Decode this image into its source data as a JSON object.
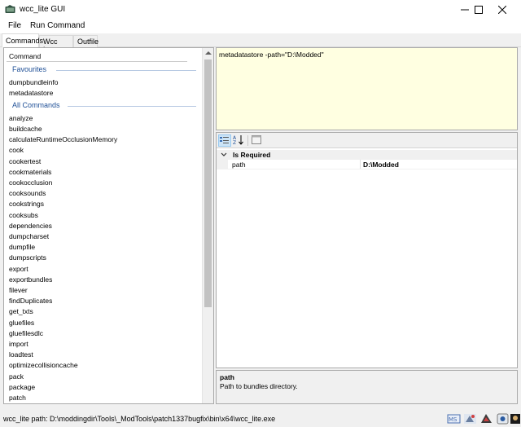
{
  "window": {
    "title": "wcc_lite GUI"
  },
  "menu": {
    "items": [
      "File",
      "Run Command"
    ]
  },
  "tabs": [
    "Commands",
    "Wcc Log",
    "Outfile"
  ],
  "commands_panel": {
    "header": "Command",
    "favourites_label": "Favourites",
    "favourites": [
      "dumpbundleinfo",
      "metadatastore"
    ],
    "all_label": "All Commands",
    "all_commands": [
      "analyze",
      "buildcache",
      "calculateRuntimeOcclusionMemory",
      "cook",
      "cookertest",
      "cookmaterials",
      "cookocclusion",
      "cooksounds",
      "cookstrings",
      "cooksubs",
      "dependencies",
      "dumpcharset",
      "dumpfile",
      "dumpscripts",
      "export",
      "exportbundles",
      "filever",
      "findDuplicates",
      "get_txts",
      "gluefiles",
      "gluefilesdlc",
      "import",
      "loadtest",
      "optimizecollisioncache",
      "pack",
      "package",
      "patch"
    ]
  },
  "command_line": "metadatastore -path=\"D:\\Modded\"",
  "property_grid": {
    "category": "Is Required",
    "property_name": "path",
    "property_value": "D:\\Modded"
  },
  "description": {
    "title": "path",
    "text": "Path to bundles directory."
  },
  "status": {
    "text": "wcc_lite path: D:\\moddingdir\\Tools\\_ModTools\\patch1337bugfix\\bin\\x64\\wcc_lite.exe"
  },
  "tray_icons": [
    "tray-app-icon-1",
    "tray-app-icon-2",
    "tray-app-icon-3",
    "tray-app-icon-4",
    "tray-app-icon-5"
  ],
  "colors": {
    "group_header": "#1e4f96",
    "command_line_bg": "#ffffe1",
    "selected_tool": "#cce4f7"
  }
}
